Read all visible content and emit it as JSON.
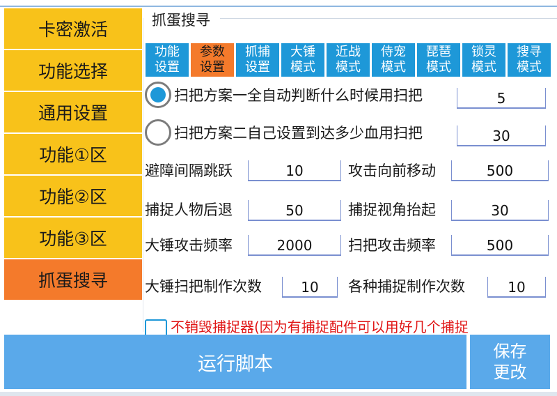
{
  "sidebar": {
    "items": [
      {
        "label": "卡密激活"
      },
      {
        "label": "功能选择"
      },
      {
        "label": "通用设置"
      },
      {
        "label": "功能①区"
      },
      {
        "label": "功能②区"
      },
      {
        "label": "功能③区"
      },
      {
        "label": "抓蛋搜寻"
      }
    ],
    "active_index": 6
  },
  "panel": {
    "title": "抓蛋搜寻"
  },
  "tabs": [
    {
      "label": "功能\n设置"
    },
    {
      "label": "参数\n设置"
    },
    {
      "label": "抓捕\n设置"
    },
    {
      "label": "大锤\n模式"
    },
    {
      "label": "近战\n模式"
    },
    {
      "label": "侍宠\n模式"
    },
    {
      "label": "琵琶\n模式"
    },
    {
      "label": "锁灵\n模式"
    },
    {
      "label": "搜寻\n模式"
    }
  ],
  "radios": {
    "option1": {
      "label": "扫把方案一全自动判断什么时候用扫把",
      "value": "5",
      "selected": true
    },
    "option2": {
      "label": "扫把方案二自己设置到达多少血用扫把",
      "value": "30",
      "selected": false
    }
  },
  "params": {
    "jump_interval": {
      "label": "避障间隔跳跃",
      "value": "10"
    },
    "attack_forward": {
      "label": "攻击向前移动",
      "value": "500"
    },
    "capture_retreat": {
      "label": "捕捉人物后退",
      "value": "50"
    },
    "capture_lift": {
      "label": "捕捉视角抬起",
      "value": "30"
    },
    "hammer_freq": {
      "label": "大锤攻击频率",
      "value": "2000"
    },
    "broom_freq": {
      "label": "扫把攻击频率",
      "value": "500"
    },
    "hammer_broom_count": {
      "label": "大锤扫把制作次数",
      "value": "10"
    },
    "capture_make_count": {
      "label": "各种捕捉制作次数",
      "value": "10"
    }
  },
  "checkbox": {
    "label": "不销毁捕捉器(因为有捕捉配件可以用好几个捕捉",
    "checked": false
  },
  "buttons": {
    "run": "运行脚本",
    "save_line1": "保存",
    "save_line2": "更改"
  },
  "colors": {
    "sidebar": "#f8c21a",
    "active": "#f47a2b",
    "tab": "#1e98d8",
    "button": "#5aa9ea",
    "warning_text": "#e01515"
  }
}
